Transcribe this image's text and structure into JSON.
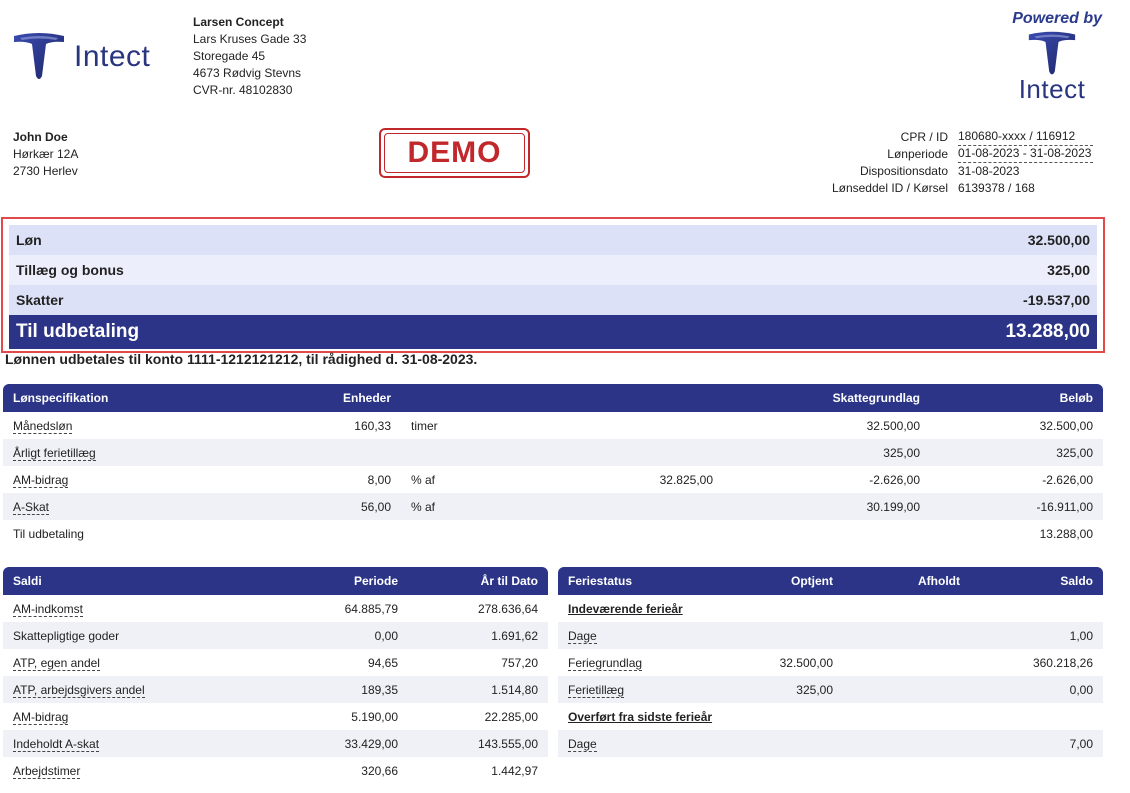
{
  "logo_text": "Intect",
  "company": {
    "name": "Larsen Concept",
    "address1": "Lars Kruses Gade 33",
    "address2": "Storegade 45",
    "city": "4673 Rødvig Stevns",
    "cvr": "CVR-nr. 48102830"
  },
  "powered": {
    "by": "Powered by",
    "word": "Intect"
  },
  "employee": {
    "name": "John Doe",
    "street": "Hørkær 12A",
    "city": "2730 Herlev"
  },
  "demo_stamp": "DEMO",
  "meta": [
    {
      "label": "CPR / ID",
      "value": "180680-xxxx / 116912"
    },
    {
      "label": "Lønperiode",
      "value": "01-08-2023 - 31-08-2023"
    },
    {
      "label": "Dispositionsdato",
      "value": "31-08-2023"
    },
    {
      "label": "Lønseddel ID / Kørsel",
      "value": "6139378 / 168"
    }
  ],
  "summary": {
    "rows": [
      {
        "label": "Løn",
        "value": "32.500,00"
      },
      {
        "label": "Tillæg og bonus",
        "value": "325,00"
      },
      {
        "label": "Skatter",
        "value": "-19.537,00"
      }
    ],
    "total_label": "Til udbetaling",
    "total_value": "13.288,00"
  },
  "payment_note": "Lønnen udbetales til konto 1111-1212121212, til rådighed d. 31-08-2023.",
  "spec": {
    "headers": [
      "Lønspecifikation",
      "Enheder",
      "Skattegrundlag",
      "Beløb"
    ],
    "rows": [
      {
        "name": "Månedsløn",
        "units": "160,33",
        "unit_type": "timer",
        "basis": "",
        "tax": "32.500,00",
        "amount": "32.500,00"
      },
      {
        "name": "Årligt ferietillæg",
        "units": "",
        "unit_type": "",
        "basis": "",
        "tax": "325,00",
        "amount": "325,00"
      },
      {
        "name": "AM-bidrag",
        "units": "8,00",
        "unit_type": "% af",
        "basis": "32.825,00",
        "tax": "-2.626,00",
        "amount": "-2.626,00"
      },
      {
        "name": "A-Skat",
        "units": "56,00",
        "unit_type": "% af",
        "basis": "",
        "tax": "30.199,00",
        "amount": "-16.911,00"
      },
      {
        "name": "Til udbetaling",
        "units": "",
        "unit_type": "",
        "basis": "",
        "tax": "",
        "amount": "13.288,00"
      }
    ]
  },
  "saldi": {
    "headers": [
      "Saldi",
      "Periode",
      "År til Dato"
    ],
    "rows": [
      {
        "name": "AM-indkomst",
        "period": "64.885,79",
        "ytd": "278.636,64"
      },
      {
        "name": "Skattepligtige goder",
        "period": "0,00",
        "ytd": "1.691,62"
      },
      {
        "name": "ATP, egen andel",
        "period": "94,65",
        "ytd": "757,20"
      },
      {
        "name": "ATP, arbejdsgivers andel",
        "period": "189,35",
        "ytd": "1.514,80"
      },
      {
        "name": "AM-bidrag",
        "period": "5.190,00",
        "ytd": "22.285,00"
      },
      {
        "name": "Indeholdt A-skat",
        "period": "33.429,00",
        "ytd": "143.555,00"
      },
      {
        "name": "Arbejdstimer",
        "period": "320,66",
        "ytd": "1.442,97"
      }
    ]
  },
  "ferie": {
    "headers": [
      "Feriestatus",
      "Optjent",
      "Afholdt",
      "Saldo"
    ],
    "section1": "Indeværende ferieår",
    "rows1": [
      {
        "name": "Dage",
        "earned": "",
        "taken": "",
        "balance": "1,00"
      },
      {
        "name": "Feriegrundlag",
        "earned": "32.500,00",
        "taken": "",
        "balance": "360.218,26"
      },
      {
        "name": "Ferietillæg",
        "earned": "325,00",
        "taken": "",
        "balance": "0,00"
      }
    ],
    "section2": "Overført fra sidste ferieår",
    "rows2": [
      {
        "name": "Dage",
        "earned": "",
        "taken": "",
        "balance": "7,00"
      }
    ]
  }
}
